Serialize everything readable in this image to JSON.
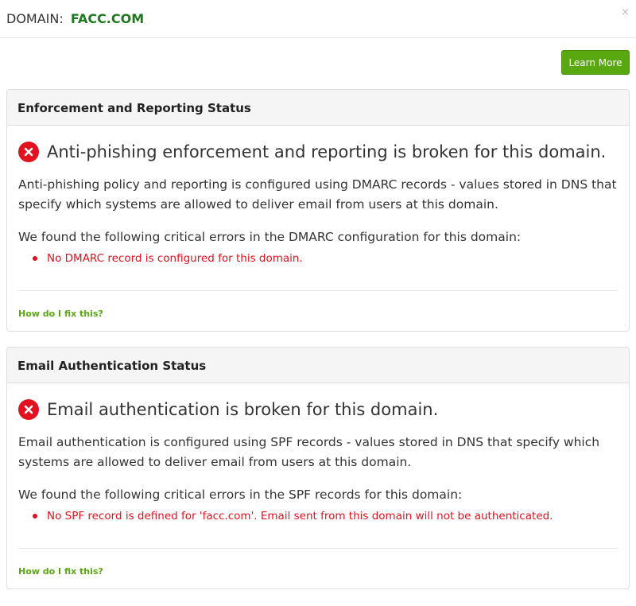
{
  "header": {
    "domain_label": "DOMAIN:",
    "domain_value": "FACC.COM",
    "close_glyph": "×"
  },
  "toolbar": {
    "learn_more_label": "Learn More"
  },
  "panels": [
    {
      "heading": "Enforcement and Reporting Status",
      "status_icon": "error-x-icon",
      "status_text": "Anti-phishing enforcement and reporting is broken for this domain.",
      "description": "Anti-phishing policy and reporting is configured using DMARC records - values stored in DNS that specify which systems are allowed to deliver email from users at this domain.",
      "errors_intro": "We found the following critical errors in the DMARC configuration for this domain:",
      "errors": [
        "No DMARC record is configured for this domain."
      ],
      "fix_link": "How do I fix this?"
    },
    {
      "heading": "Email Authentication Status",
      "status_icon": "error-x-icon",
      "status_text": "Email authentication is broken for this domain.",
      "description": "Email authentication is configured using SPF records - values stored in DNS that specify which systems are allowed to deliver email from users at this domain.",
      "errors_intro": "We found the following critical errors in the SPF records for this domain:",
      "errors": [
        "No SPF record is defined for 'facc.com'. Email sent from this domain will not be authenticated."
      ],
      "fix_link": "How do I fix this?"
    }
  ],
  "colors": {
    "accent_green": "#59a80f",
    "domain_green": "#1f7a1f",
    "error_red": "#e3101d"
  }
}
